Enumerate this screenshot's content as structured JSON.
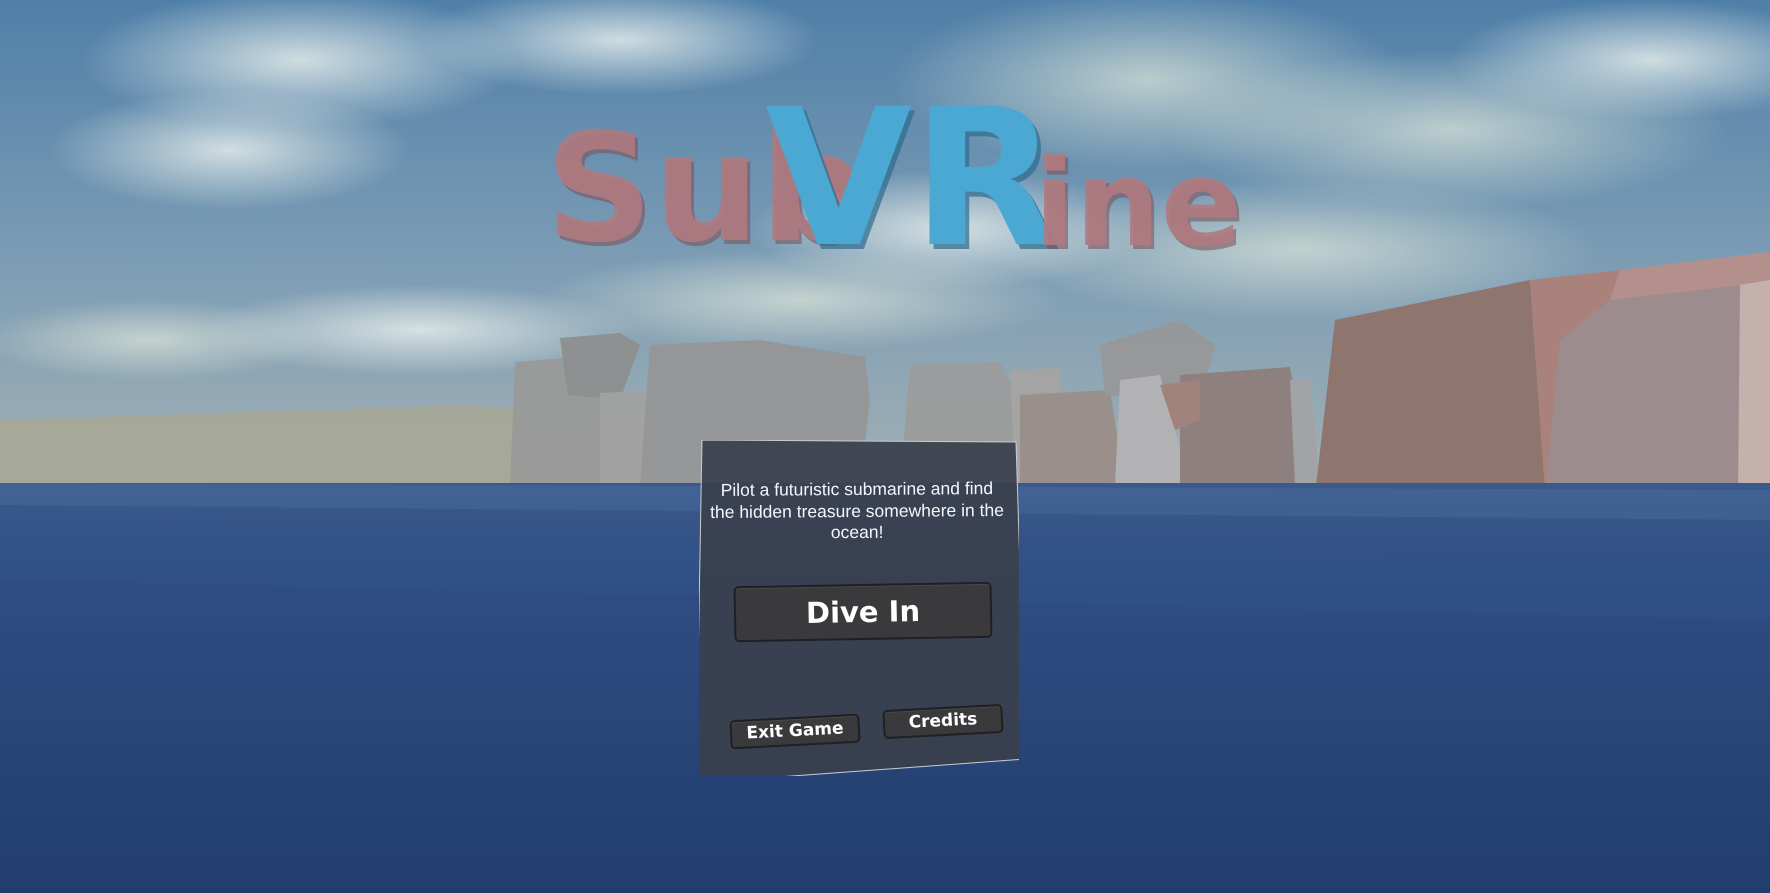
{
  "game": {
    "title_part1": "Sub",
    "title_part2": "VR",
    "title_part3": "ine"
  },
  "menu": {
    "description": "Pilot a futuristic submarine and find the hidden treasure somewhere in the ocean!",
    "dive_in_label": "Dive In",
    "exit_game_label": "Exit Game",
    "credits_label": "Credits"
  },
  "colors": {
    "title_pink": "#b07a80",
    "title_blue": "#4aa8d2",
    "ocean": "#2c4879",
    "panel": "#3a3f4d"
  }
}
